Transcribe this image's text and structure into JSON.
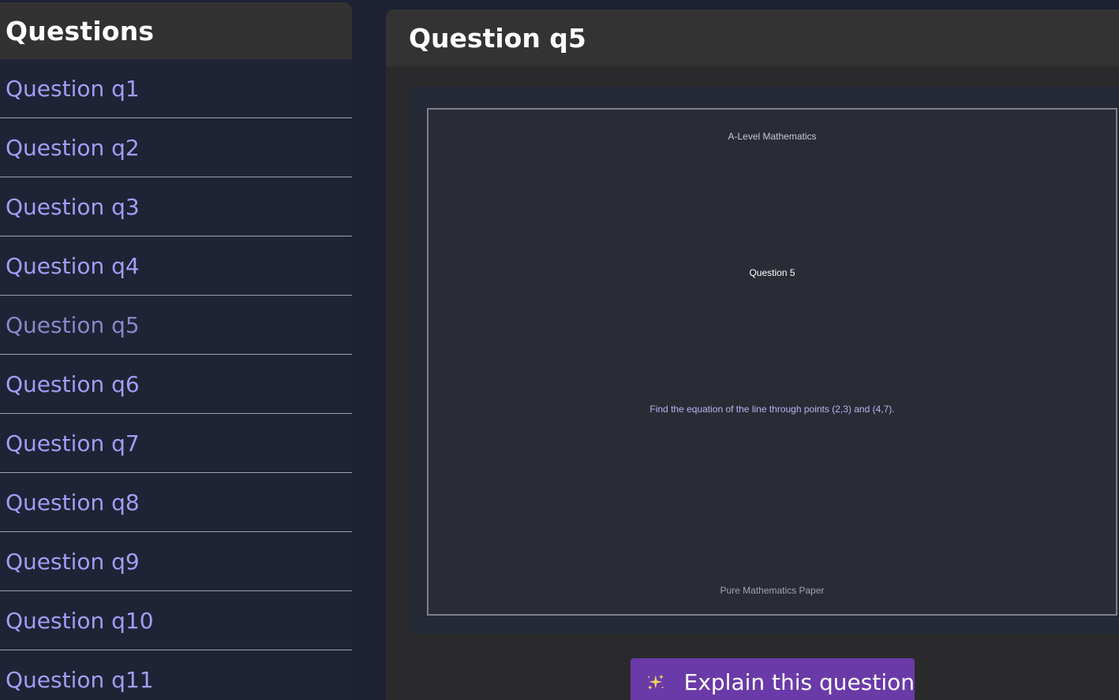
{
  "sidebar": {
    "title": "Questions",
    "items": [
      {
        "label": "Question q1"
      },
      {
        "label": "Question q2"
      },
      {
        "label": "Question q3"
      },
      {
        "label": "Question q4"
      },
      {
        "label": "Question q5",
        "active": true
      },
      {
        "label": "Question q6"
      },
      {
        "label": "Question q7"
      },
      {
        "label": "Question q8"
      },
      {
        "label": "Question q9"
      },
      {
        "label": "Question q10"
      },
      {
        "label": "Question q11"
      }
    ]
  },
  "main": {
    "title": "Question q5",
    "paper": {
      "header": "A-Level Mathematics",
      "question_number": "Question 5",
      "body": "Find the equation of the line through points (2,3) and (4,7).",
      "footer": "Pure Mathematics Paper"
    },
    "explain_button": {
      "label": "Explain this question",
      "icon": "sparkle-icon"
    }
  },
  "colors": {
    "accent": "#a49cf5",
    "button": "#6a3aa8",
    "sparkle": "#f4d35e"
  }
}
